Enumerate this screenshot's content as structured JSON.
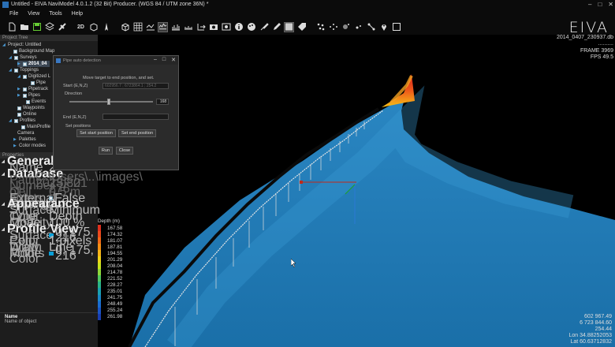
{
  "window": {
    "title": "Untitled - EIVA NaviModel 4.0.1.2 (32 Bit) Producer. (WGS 84 / UTM zone 36N) *"
  },
  "menu": [
    "File",
    "View",
    "Tools",
    "Help"
  ],
  "toolbar": {
    "logo": "EIVA",
    "view_2d": "2D"
  },
  "project_tree": {
    "header": "Project Tree",
    "items": [
      "Project: Untitled",
      "Background Map",
      "Surveys",
      "2014_04",
      "Toppings",
      "Digitized L",
      "Pipe",
      "Pipetrack",
      "Pipes",
      "Events",
      "Waypoints",
      "Online",
      "Profiles",
      "MainProfile",
      "Camera",
      "Palettes",
      "Color modes"
    ]
  },
  "properties": {
    "header": "Properties",
    "general": "General",
    "name_label": "Name",
    "name_value": "2",
    "database": "Database",
    "db_rows": [
      {
        "k": "Path",
        "v": "C:\\Users\\..\\images\\ 2015F.2"
      },
      {
        "k": "Number of points",
        "v": "23 801 276"
      },
      {
        "k": "Cell size",
        "v": "0.5 m"
      },
      {
        "k": "External Saving/Lo",
        "v": "False"
      }
    ],
    "appearance": "Appearance",
    "app_rows": [
      {
        "k": "Surface Type",
        "v": "Minimum"
      },
      {
        "k": "Color Mode",
        "v": "Depth"
      },
      {
        "k": "Opacity",
        "v": "100 %"
      }
    ],
    "profile_view": "Profile View",
    "pv_rows": [
      {
        "k": "Surface Color",
        "v": "0, 175, 216"
      },
      {
        "k": "Pen Width",
        "v": "1 pixels"
      },
      {
        "k": "Draw Mode",
        "v": "Line"
      },
      {
        "k": "Points Color",
        "v": "0, 175, 216"
      }
    ],
    "surface_color": "#0aa0d8"
  },
  "description": {
    "title": "Name",
    "text": "Name of object"
  },
  "dialog": {
    "title": "Pipe auto detection",
    "instruction": "Move target to end position, and set.",
    "start_label": "Start (E,N,Z)",
    "start_value": "602956.7 ; 6723864.1 ; 254.2",
    "direction_label": "Direction",
    "direction_value": "168",
    "direction_fraction": 0.47,
    "end_label": "End (E,N,Z)",
    "end_value": "",
    "set_positions": "Set positions",
    "set_start": "Set start position",
    "set_end": "Set end position",
    "run": "Run",
    "close": "Close"
  },
  "viewport": {
    "file": "2014_0407_230937.db",
    "file_dots": "..........",
    "frame": "FRAME 3969",
    "fps": "FPS 49.5",
    "coords": [
      "602 967.49",
      "6 723 844.60",
      "254.44",
      "Lon 34.88252053",
      "Lat 60.63712832"
    ]
  },
  "legend": {
    "title": "Depth (m)",
    "values": [
      "167.58",
      "174.32",
      "181.07",
      "187.81",
      "194.55",
      "201.29",
      "208.04",
      "214.78",
      "221.52",
      "228.27",
      "235.01",
      "241.75",
      "248.49",
      "255.24",
      "261.98"
    ],
    "colors": [
      "#e0301e",
      "#ea4a1c",
      "#f06a18",
      "#f48f16",
      "#f6b418",
      "#eed41a",
      "#c8e21e",
      "#8ed83a",
      "#52c860",
      "#2ab488",
      "#1aa0b0",
      "#1a86c8",
      "#1a6cd0",
      "#1a54c4",
      "#1a3eb0"
    ]
  }
}
